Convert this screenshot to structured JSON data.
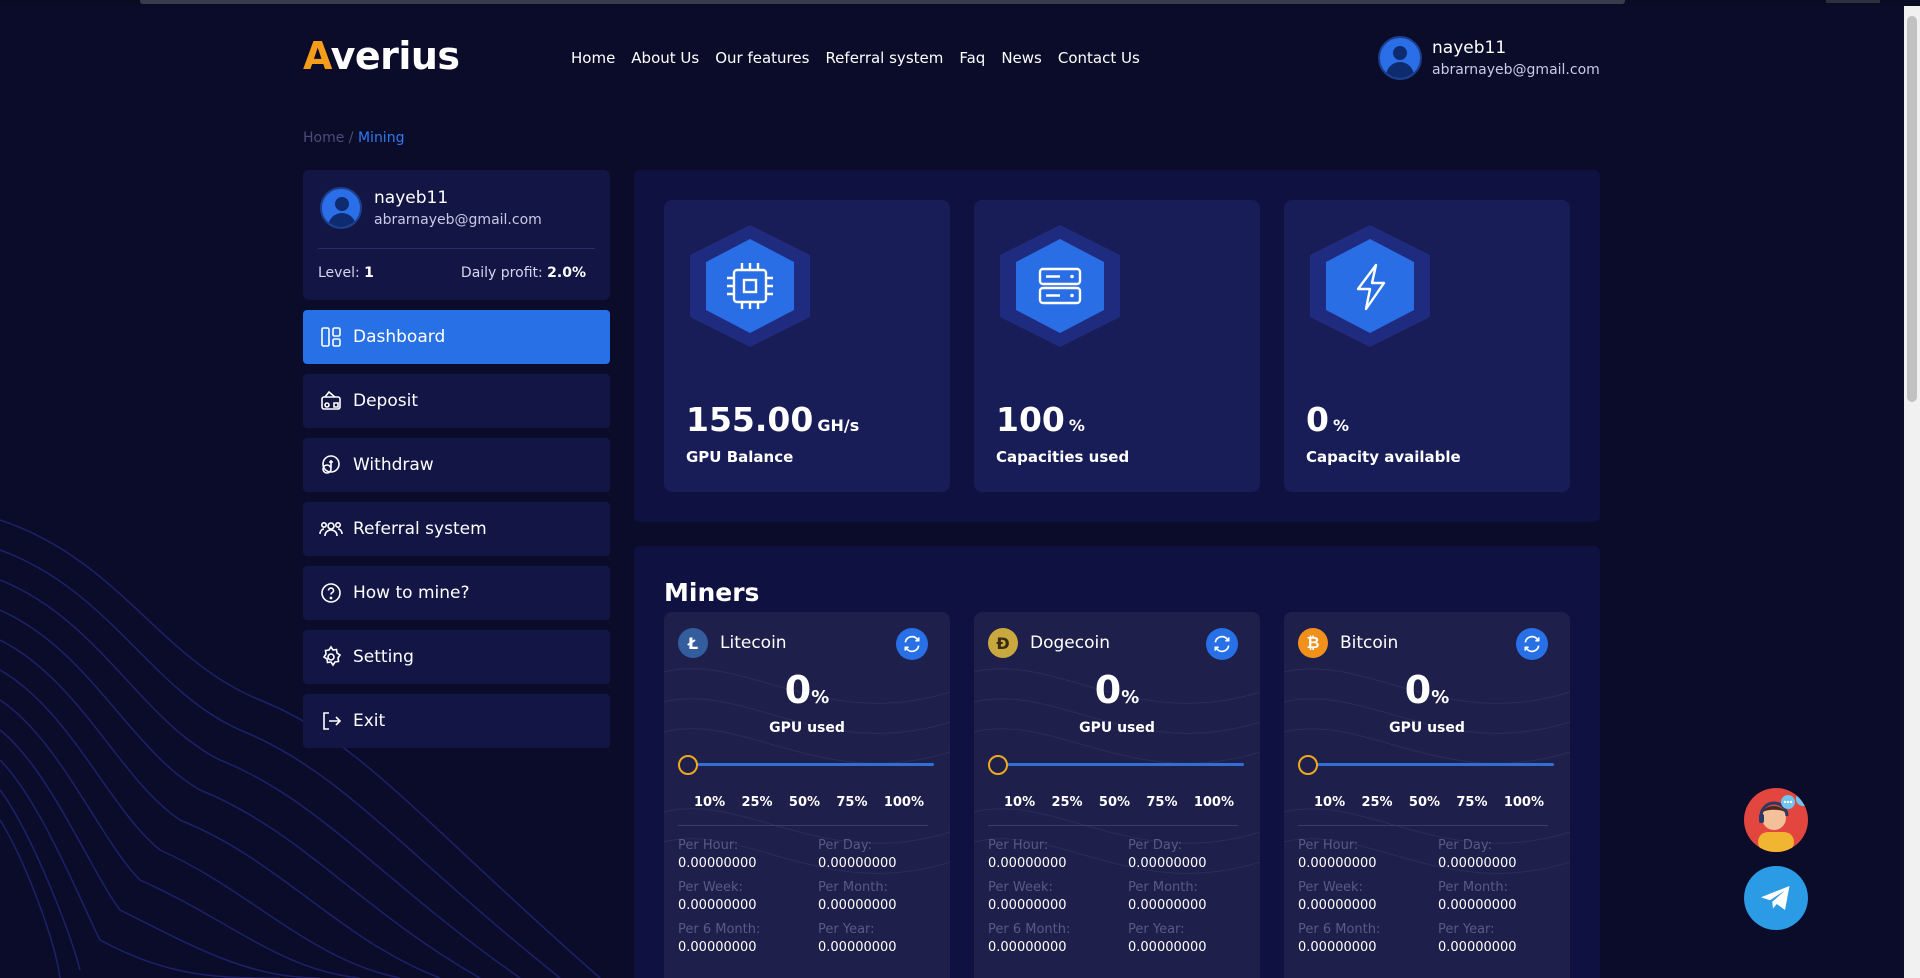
{
  "header": {
    "logo_first": "A",
    "logo_rest": "verius",
    "nav": [
      "Home",
      "About Us",
      "Our features",
      "Referral system",
      "Faq",
      "News",
      "Contact Us"
    ],
    "user": {
      "name": "nayeb11",
      "email": "abrarnayeb@gmail.com"
    }
  },
  "breadcrumb": {
    "home": "Home",
    "separator": " / ",
    "current": "Mining"
  },
  "profile": {
    "name": "nayeb11",
    "email": "abrarnayeb@gmail.com",
    "level_label": "Level: ",
    "level_value": "1",
    "profit_label": "Daily profit: ",
    "profit_value": "2.0%"
  },
  "menu": [
    {
      "label": "Dashboard",
      "icon": "dashboard-icon",
      "active": true
    },
    {
      "label": "Deposit",
      "icon": "wallet-icon",
      "active": false
    },
    {
      "label": "Withdraw",
      "icon": "coins-icon",
      "active": false
    },
    {
      "label": "Referral system",
      "icon": "users-icon",
      "active": false
    },
    {
      "label": "How to mine?",
      "icon": "question-icon",
      "active": false
    },
    {
      "label": "Setting",
      "icon": "gear-icon",
      "active": false
    },
    {
      "label": "Exit",
      "icon": "logout-icon",
      "active": false
    }
  ],
  "stats": [
    {
      "value": "155.00",
      "unit": "GH/s",
      "label": "GPU Balance",
      "icon": "cpu-icon"
    },
    {
      "value": "100",
      "unit": "%",
      "label": "Capacities used",
      "icon": "server-icon"
    },
    {
      "value": "0",
      "unit": "%",
      "label": "Capacity available",
      "icon": "lightning-icon"
    }
  ],
  "miners": {
    "title": "Miners",
    "ticks": [
      "10%",
      "25%",
      "50%",
      "75%",
      "100%"
    ],
    "gpu_label": "GPU used",
    "coins": [
      {
        "name": "Litecoin",
        "icon": "litecoin-icon",
        "percent": "0",
        "percent_sign": "%",
        "slider": 0,
        "earnings": {
          "per_hour_label": "Per Hour:",
          "per_hour": "0.00000000",
          "per_day_label": "Per Day:",
          "per_day": "0.00000000",
          "per_week_label": "Per Week:",
          "per_week": "0.00000000",
          "per_month_label": "Per Month:",
          "per_month": "0.00000000",
          "per_6month_label": "Per 6 Month:",
          "per_6month": "0.00000000",
          "per_year_label": "Per Year:",
          "per_year": "0.00000000"
        }
      },
      {
        "name": "Dogecoin",
        "icon": "dogecoin-icon",
        "percent": "0",
        "percent_sign": "%",
        "slider": 0,
        "earnings": {
          "per_hour_label": "Per Hour:",
          "per_hour": "0.00000000",
          "per_day_label": "Per Day:",
          "per_day": "0.00000000",
          "per_week_label": "Per Week:",
          "per_week": "0.00000000",
          "per_month_label": "Per Month:",
          "per_month": "0.00000000",
          "per_6month_label": "Per 6 Month:",
          "per_6month": "0.00000000",
          "per_year_label": "Per Year:",
          "per_year": "0.00000000"
        }
      },
      {
        "name": "Bitcoin",
        "icon": "bitcoin-icon",
        "percent": "0",
        "percent_sign": "%",
        "slider": 0,
        "earnings": {
          "per_hour_label": "Per Hour:",
          "per_hour": "0.00000000",
          "per_day_label": "Per Day:",
          "per_day": "0.00000000",
          "per_week_label": "Per Week:",
          "per_week": "0.00000000",
          "per_month_label": "Per Month:",
          "per_month": "0.00000000",
          "per_6month_label": "Per 6 Month:",
          "per_6month": "0.00000000",
          "per_year_label": "Per Year:",
          "per_year": "0.00000000"
        }
      }
    ]
  },
  "colors": {
    "background": "#0b0c2a",
    "accent": "#2870e6",
    "logo_accent": "#f59d1a",
    "card": "#131645"
  },
  "floating": {
    "support": "support-agent-icon",
    "telegram": "telegram-icon"
  }
}
